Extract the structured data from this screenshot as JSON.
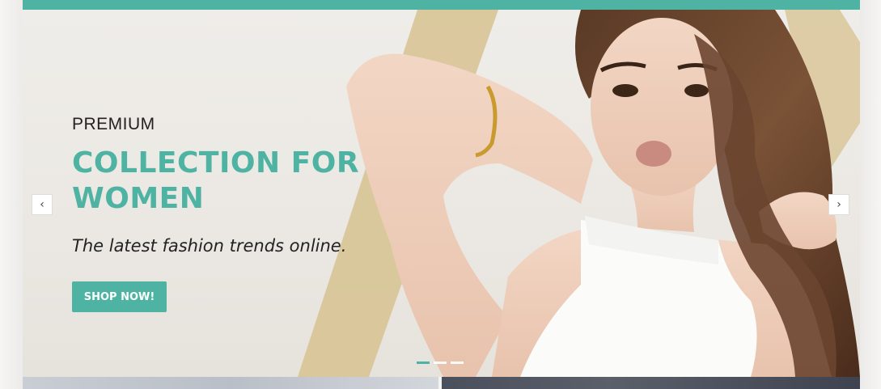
{
  "hero": {
    "kicker": "PREMIUM",
    "headline": "COLLECTION FOR WOMEN",
    "tagline": "The latest fashion trends online.",
    "cta_label": "SHOP NOW!",
    "prev_icon": "‹",
    "next_icon": "›",
    "slide_count": 3,
    "active_slide": 1
  },
  "colors": {
    "accent": "#4eb3a2",
    "text_dark": "#222222",
    "stripe_gold": "#d7c290"
  },
  "icons": {
    "prev": "chevron-left-icon",
    "next": "chevron-right-icon"
  }
}
